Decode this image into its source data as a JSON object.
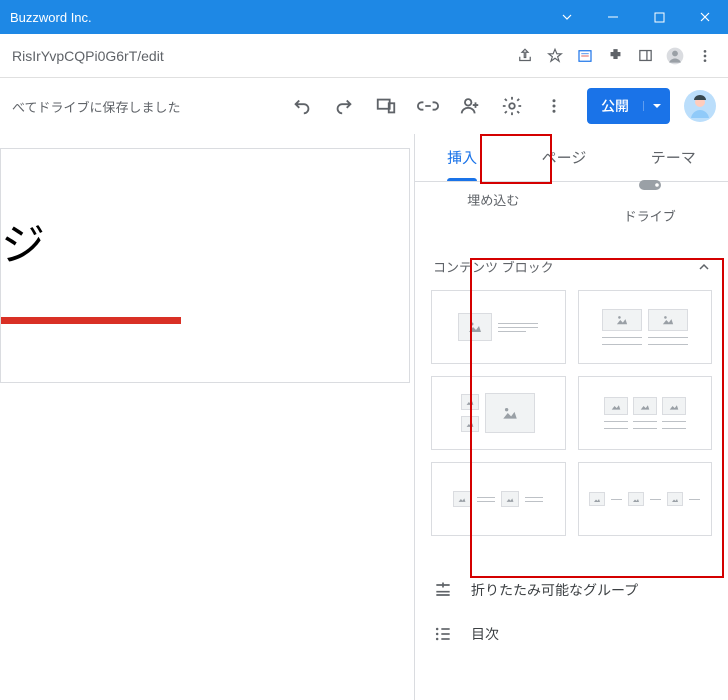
{
  "titlebar": {
    "title": "Buzzword Inc."
  },
  "addressbar": {
    "url": "RisIrYvpCQPi0G6rT/edit"
  },
  "toolbar": {
    "status": "べてドライブに保存しました",
    "publish_label": "公開"
  },
  "canvas": {
    "page_title": "ジ"
  },
  "sidepanel": {
    "tabs": {
      "insert": "挿入",
      "page": "ページ",
      "theme": "テーマ"
    },
    "embed_label": "埋め込む",
    "drive_label": "ドライブ",
    "content_blocks_header": "コンテンツ ブロック",
    "collapsible_group": "折りたたみ可能なグループ",
    "toc": "目次"
  }
}
